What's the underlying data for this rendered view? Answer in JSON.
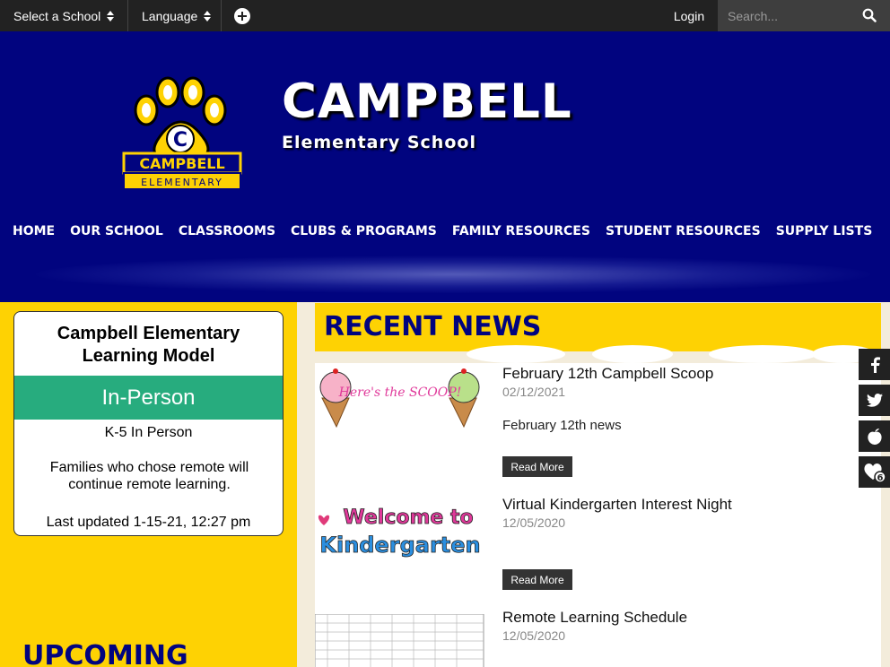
{
  "topbar": {
    "school_select": "Select a School",
    "language_select": "Language",
    "login": "Login",
    "search_placeholder": "Search..."
  },
  "header": {
    "title": "CAMPBELL",
    "subtitle": "Elementary School",
    "logo_text_1": "CAMPBELL",
    "logo_text_2": "ELEMENTARY",
    "logo_letter": "C"
  },
  "nav": {
    "items": [
      "HOME",
      "OUR SCHOOL",
      "CLASSROOMS",
      "CLUBS & PROGRAMS",
      "FAMILY RESOURCES",
      "STUDENT RESOURCES",
      "SUPPLY LISTS"
    ]
  },
  "learning_model": {
    "title_line1": "Campbell Elementary",
    "title_line2": "Learning Model",
    "status": "In-Person",
    "grades": "K-5 In Person",
    "note": "Families who chose remote will continue remote learning.",
    "updated": "Last updated 1-15-21, 12:27 pm"
  },
  "upcoming": {
    "heading": "UPCOMING"
  },
  "news": {
    "heading": "RECENT NEWS",
    "items": [
      {
        "title": "February 12th Campbell Scoop",
        "date": "02/12/2021",
        "summary": "February 12th news",
        "read_more": "Read More",
        "thumb_text": "Here's the SCOOP!"
      },
      {
        "title": "Virtual Kindergarten Interest Night",
        "date": "12/05/2020",
        "read_more": "Read More",
        "thumb_text_1": "Welcome to",
        "thumb_text_2": "Kindergarten"
      },
      {
        "title": "Remote Learning Schedule",
        "date": "12/05/2020"
      }
    ]
  },
  "social": {
    "favorites_count": "6"
  },
  "colors": {
    "navy": "#01047f",
    "gold": "#fed203",
    "green": "#27ac7e"
  }
}
